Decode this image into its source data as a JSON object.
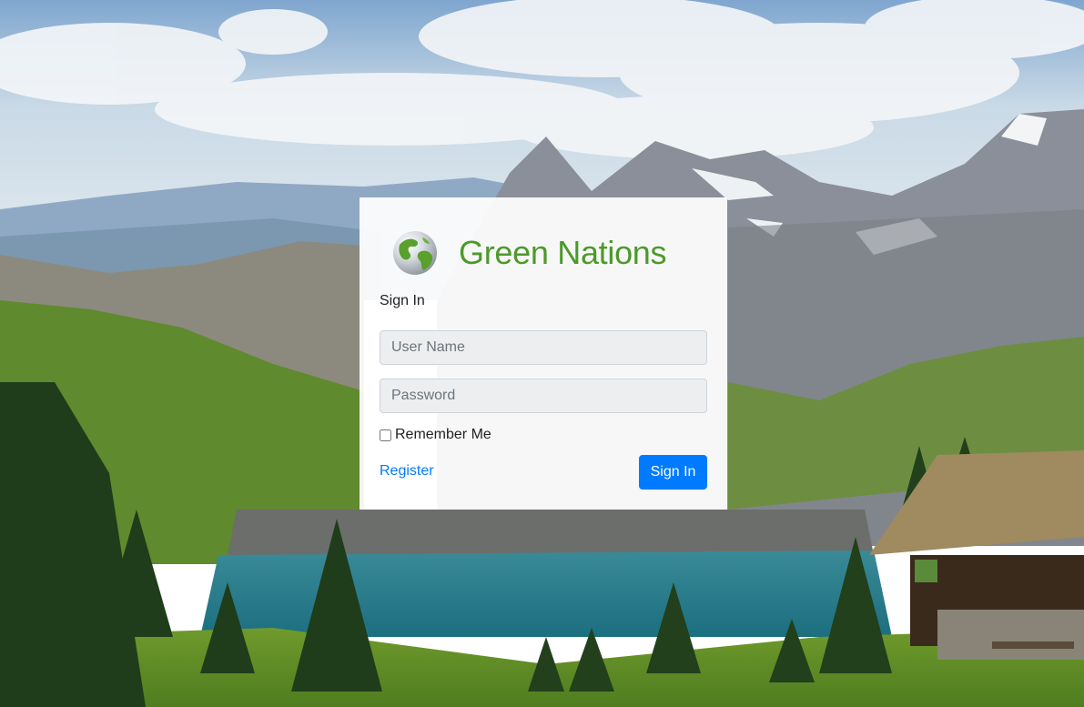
{
  "brand": {
    "name": "Green Nations",
    "logo_icon": "globe-icon",
    "accent_color": "#4c9a2a"
  },
  "background": {
    "description_icon": "mountain-lake-landscape"
  },
  "login": {
    "heading": "Sign In",
    "username_placeholder": "User Name",
    "password_placeholder": "Password",
    "remember_label": "Remember Me",
    "register_link": "Register",
    "submit_label": "Sign In",
    "primary_color": "#007bff",
    "link_color": "#007bff"
  }
}
